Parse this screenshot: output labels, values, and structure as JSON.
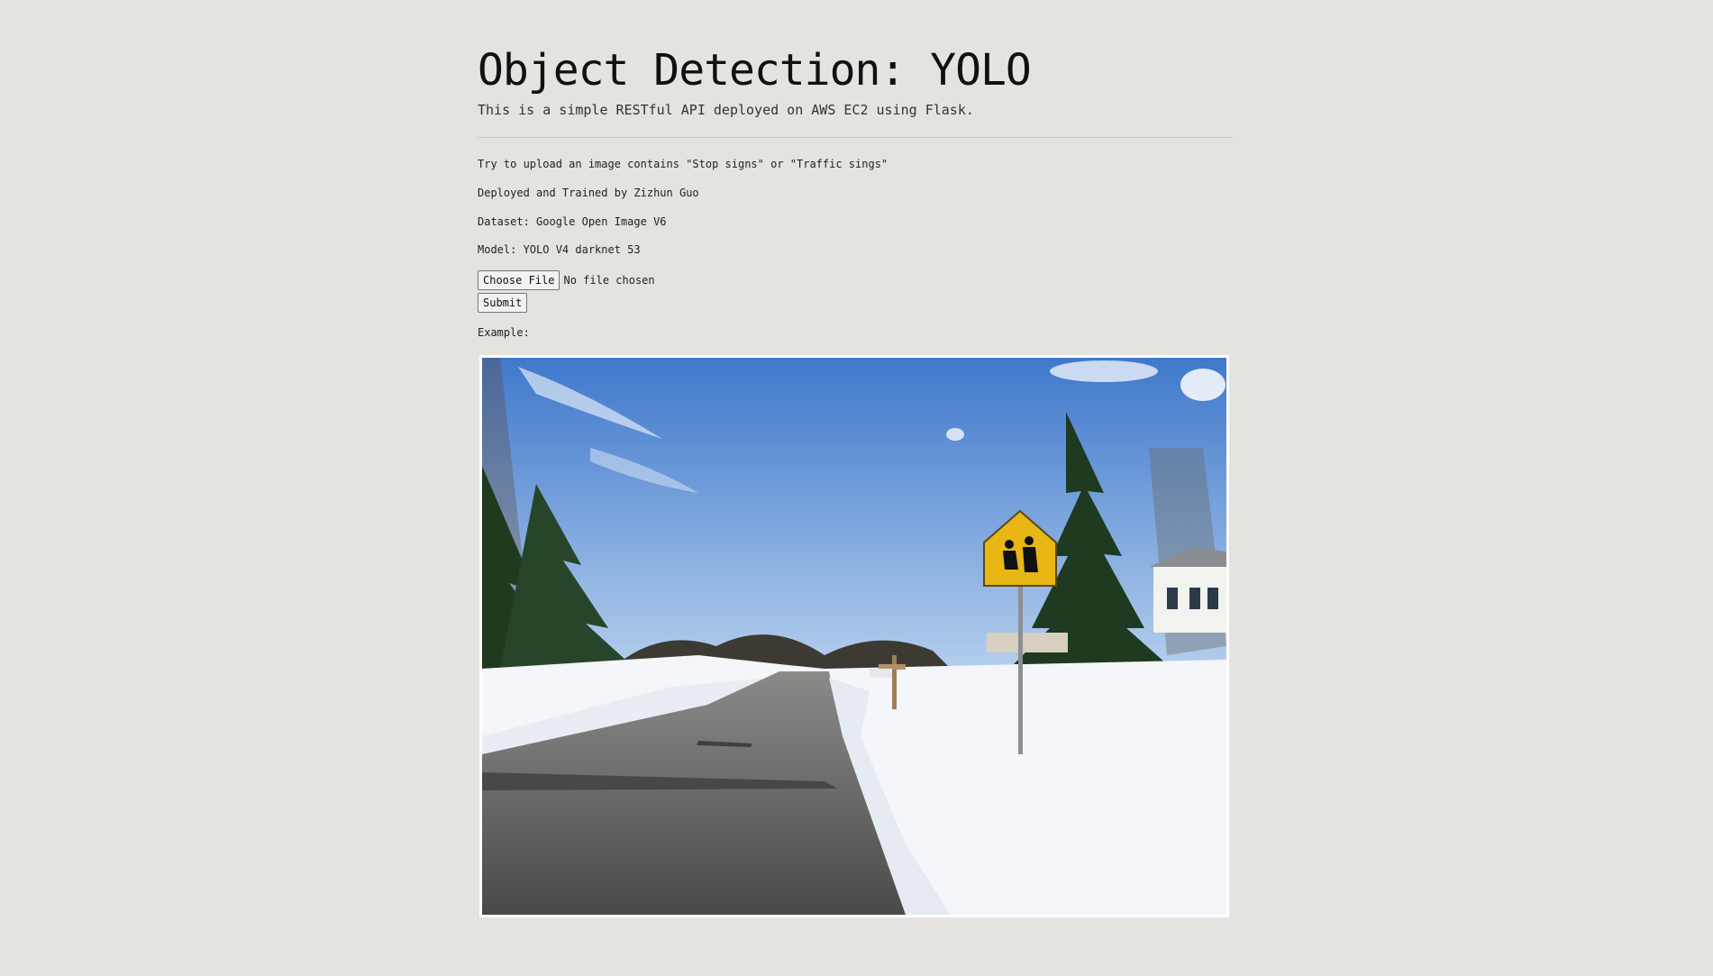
{
  "header": {
    "title": "Object Detection: YOLO",
    "subtitle": "This is a simple RESTful API deployed on AWS EC2 using Flask."
  },
  "info": {
    "hint": "Try to upload an image contains \"Stop signs\" or \"Traffic sings\"",
    "author": "Deployed and Trained by Zizhun Guo",
    "dataset": "Dataset: Google Open Image V6",
    "model": "Model: YOLO V4 darknet 53"
  },
  "upload": {
    "choose_label": "Choose File",
    "file_status": "No file chosen",
    "submit_label": "Submit"
  },
  "example": {
    "label": "Example:"
  }
}
